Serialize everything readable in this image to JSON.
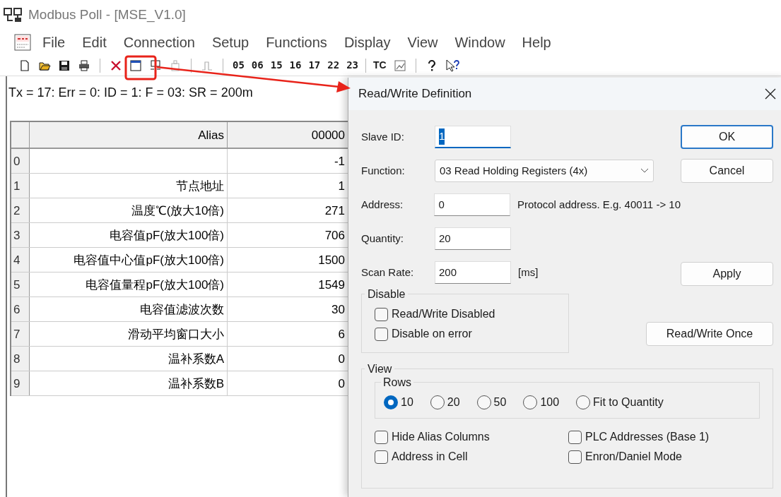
{
  "window": {
    "title": "Modbus Poll - [MSE_V1.0]"
  },
  "menu": [
    "File",
    "Edit",
    "Connection",
    "Setup",
    "Functions",
    "Display",
    "View",
    "Window",
    "Help"
  ],
  "toolbar": {
    "icons_left": [
      {
        "kind": "new"
      },
      {
        "kind": "open"
      },
      {
        "kind": "save"
      },
      {
        "kind": "print"
      },
      {
        "kind": "sep"
      },
      {
        "kind": "disconnect"
      },
      {
        "kind": "window"
      },
      {
        "kind": "connect"
      },
      {
        "kind": "device",
        "disabled": true
      },
      {
        "kind": "sep"
      },
      {
        "kind": "pulse",
        "disabled": true
      },
      {
        "kind": "sep"
      }
    ],
    "function_codes": [
      "05",
      "06",
      "15",
      "16",
      "17",
      "22",
      "23"
    ],
    "tc": "TC",
    "icons_right": [
      {
        "kind": "chart"
      },
      {
        "kind": "sep"
      },
      {
        "kind": "help"
      },
      {
        "kind": "context-help"
      }
    ]
  },
  "status_line": "Tx = 17: Err = 0: ID = 1: F = 03: SR = 200m",
  "table": {
    "columns": [
      "Alias",
      "00000"
    ],
    "rows": [
      {
        "number": "0",
        "value": "-1"
      },
      {
        "number": "1",
        "alias": "节点地址",
        "value": "1"
      },
      {
        "number": "2",
        "alias": "温度℃(放大10倍)",
        "value": "271"
      },
      {
        "number": "3",
        "alias": "电容值pF(放大100倍)",
        "value": "706"
      },
      {
        "number": "4",
        "alias": "电容值中心值pF(放大100倍)",
        "value": "1500"
      },
      {
        "number": "5",
        "alias": "电容值量程pF(放大100倍)",
        "value": "1549"
      },
      {
        "number": "6",
        "alias": "电容值滤波次数",
        "value": "30"
      },
      {
        "number": "7",
        "alias": "滑动平均窗口大小",
        "value": "6"
      },
      {
        "number": "8",
        "alias": "温补系数A",
        "value": "0"
      },
      {
        "number": "9",
        "alias": "温补系数B",
        "value": "0"
      }
    ]
  },
  "dialog": {
    "title": "Read/Write Definition",
    "fields": [
      {
        "kind": "text",
        "label": "Slave ID:",
        "value": "1",
        "focused": true
      },
      {
        "kind": "combo",
        "label": "Function:",
        "value": "03 Read Holding Registers (4x)"
      },
      {
        "kind": "text",
        "label": "Address:",
        "value": "0",
        "focused": false,
        "note": "Protocol address. E.g. 40011 -> 10"
      },
      {
        "kind": "text",
        "label": "Quantity:",
        "value": "20",
        "focused": false
      },
      {
        "kind": "text",
        "label": "Scan Rate:",
        "value": "200",
        "focused": false,
        "note": "[ms]"
      }
    ],
    "buttons": [
      {
        "label": "OK",
        "default": true
      },
      {
        "label": "Cancel",
        "default": false
      },
      {
        "label": "Apply",
        "default": false
      }
    ],
    "disable": {
      "title": "Disable",
      "checkboxes": [
        {
          "label": "Read/Write Disabled",
          "checked": false
        },
        {
          "label": "Disable on error",
          "checked": false
        }
      ],
      "button": "Read/Write Once"
    },
    "view": {
      "title": "View",
      "rows": {
        "title": "Rows",
        "options": [
          {
            "label": "10",
            "selected": true
          },
          {
            "label": "20",
            "selected": false
          },
          {
            "label": "50",
            "selected": false
          },
          {
            "label": "100",
            "selected": false
          },
          {
            "label": "Fit to Quantity",
            "selected": false
          }
        ]
      },
      "checkboxes": [
        {
          "label": "Hide Alias Columns",
          "checked": false
        },
        {
          "label": "PLC Addresses (Base 1)",
          "checked": false
        },
        {
          "label": "Address in Cell",
          "checked": false
        },
        {
          "label": "Enron/Daniel Mode",
          "checked": false
        }
      ]
    }
  }
}
